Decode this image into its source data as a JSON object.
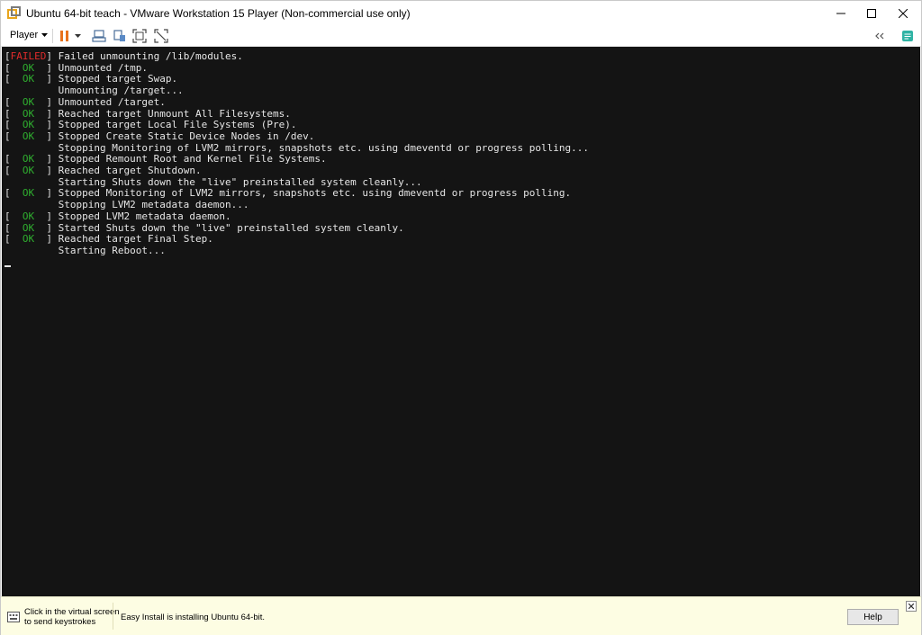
{
  "window": {
    "title": "Ubuntu 64-bit teach - VMware Workstation 15 Player (Non-commercial use only)"
  },
  "toolbar": {
    "player_label": "Player",
    "pause_color": "#e8711c"
  },
  "console": {
    "lines": [
      {
        "status": "FAILED",
        "text": "Failed unmounting /lib/modules."
      },
      {
        "status": "OK",
        "text": "Unmounted /tmp."
      },
      {
        "status": "OK",
        "text": "Stopped target Swap."
      },
      {
        "status": "",
        "text": "Unmounting /target..."
      },
      {
        "status": "OK",
        "text": "Unmounted /target."
      },
      {
        "status": "OK",
        "text": "Reached target Unmount All Filesystems."
      },
      {
        "status": "OK",
        "text": "Stopped target Local File Systems (Pre)."
      },
      {
        "status": "OK",
        "text": "Stopped Create Static Device Nodes in /dev."
      },
      {
        "status": "",
        "text": "Stopping Monitoring of LVM2 mirrors, snapshots etc. using dmeventd or progress polling..."
      },
      {
        "status": "OK",
        "text": "Stopped Remount Root and Kernel File Systems."
      },
      {
        "status": "OK",
        "text": "Reached target Shutdown."
      },
      {
        "status": "",
        "text": "Starting Shuts down the \"live\" preinstalled system cleanly..."
      },
      {
        "status": "OK",
        "text": "Stopped Monitoring of LVM2 mirrors, snapshots etc. using dmeventd or progress polling."
      },
      {
        "status": "",
        "text": "Stopping LVM2 metadata daemon..."
      },
      {
        "status": "OK",
        "text": "Stopped LVM2 metadata daemon."
      },
      {
        "status": "OK",
        "text": "Started Shuts down the \"live\" preinstalled system cleanly."
      },
      {
        "status": "OK",
        "text": "Reached target Final Step."
      },
      {
        "status": "",
        "text": "Starting Reboot..."
      }
    ]
  },
  "statusbar": {
    "hint_line1": "Click in the virtual screen",
    "hint_line2": "to send keystrokes",
    "message": "Easy Install is installing Ubuntu 64-bit.",
    "help_label": "Help"
  }
}
